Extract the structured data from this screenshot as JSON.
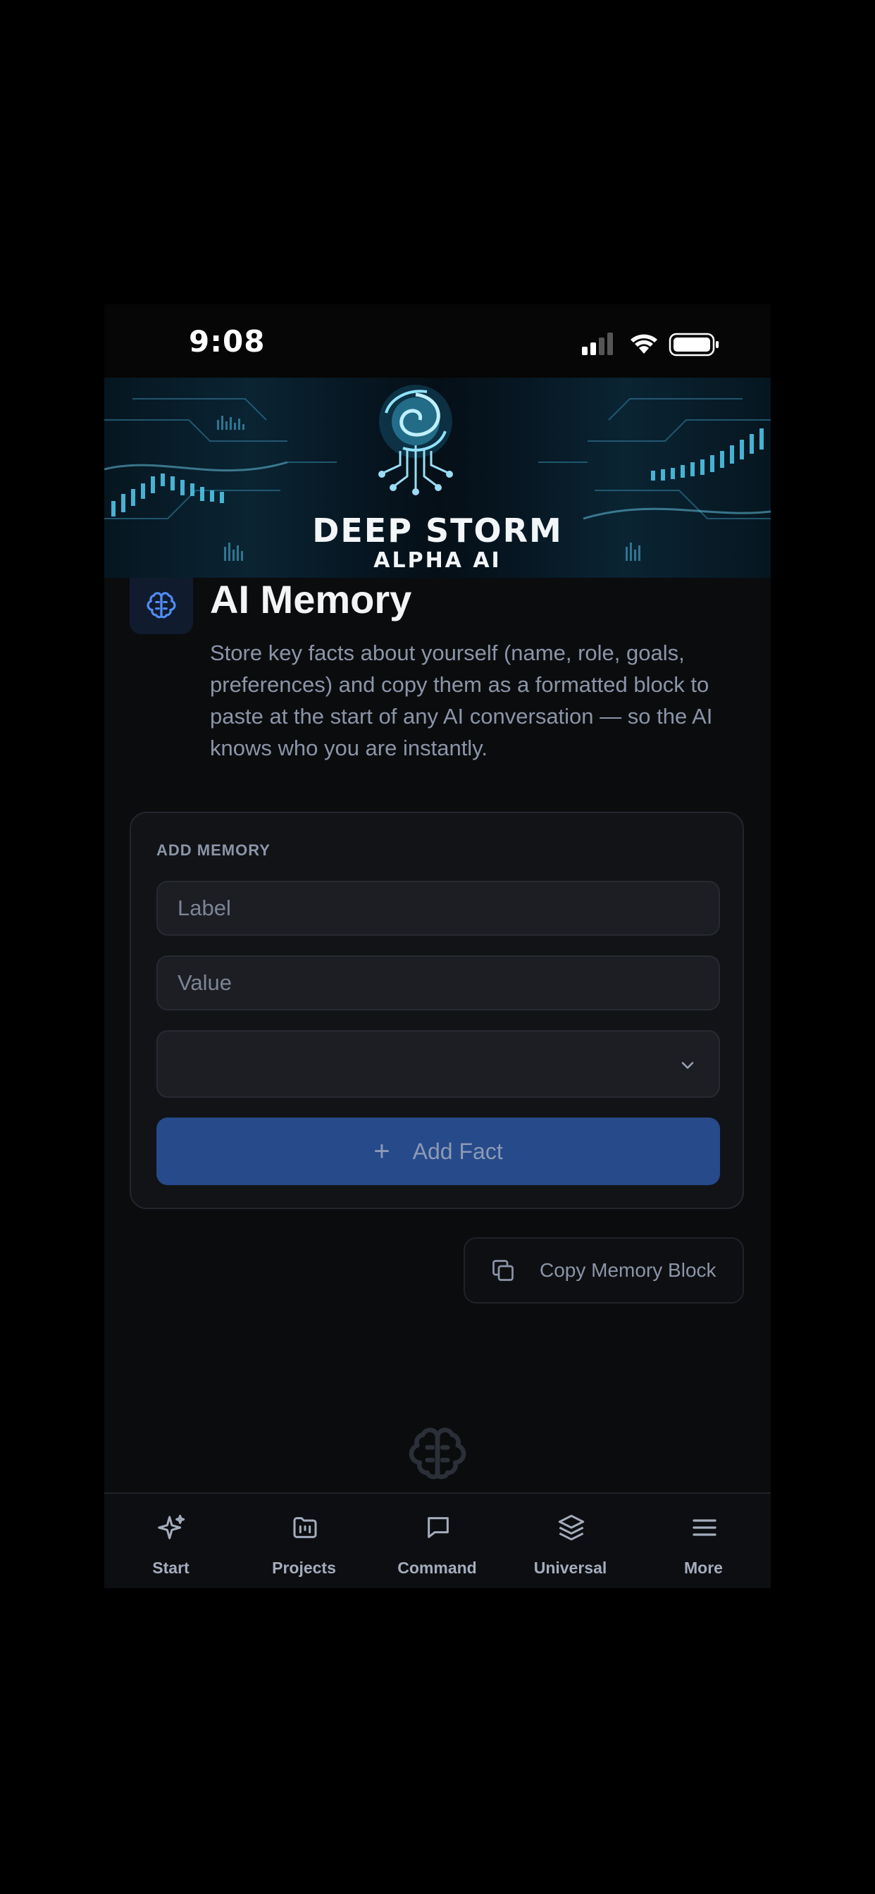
{
  "status_bar": {
    "time": "9:08"
  },
  "banner": {
    "title": "DEEP STORM",
    "subtitle": "ALPHA AI"
  },
  "page": {
    "title": "AI Memory",
    "description": "Store key facts about yourself (name, role, goals, preferences) and copy them as a formatted block to paste at the start of any AI conversation — so the AI knows who you are instantly."
  },
  "add_memory": {
    "section_label": "ADD MEMORY",
    "label_placeholder": "Label",
    "value_placeholder": "Value",
    "category_selected": "",
    "add_button": "Add Fact"
  },
  "copy_button": "Copy Memory Block",
  "tabs": [
    {
      "label": "Start",
      "icon": "sparkles-icon"
    },
    {
      "label": "Projects",
      "icon": "folder-icon"
    },
    {
      "label": "Command",
      "icon": "chat-bubble-icon"
    },
    {
      "label": "Universal",
      "icon": "layers-icon"
    },
    {
      "label": "More",
      "icon": "menu-icon"
    }
  ],
  "colors": {
    "background": "#0b0c0e",
    "accent": "#264a8a",
    "icon_blue": "#4f8ff7",
    "text_muted": "#8b95a8"
  }
}
